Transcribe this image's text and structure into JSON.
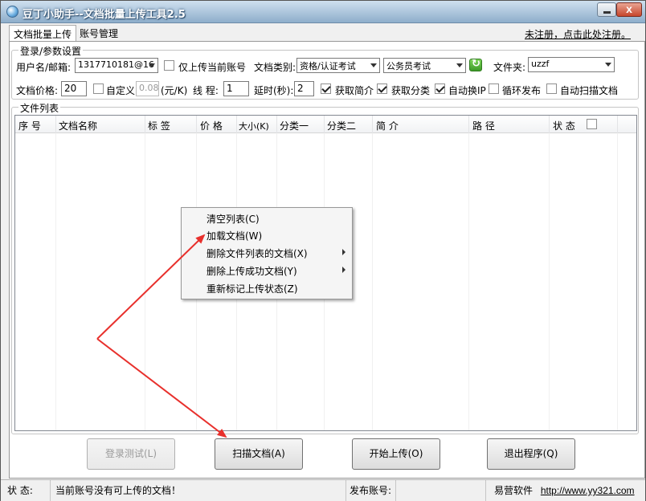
{
  "window": {
    "title": "豆丁小助手--文档批量上传工具2.5"
  },
  "tabs": [
    {
      "label": "文档批量上传",
      "active": true
    },
    {
      "label": "账号管理",
      "active": false
    }
  ],
  "register_link": "未注册，点击此处注册。",
  "settings": {
    "group_label": "登录/参数设置",
    "username_label": "用户名/邮箱:",
    "username_value": "1317710181@16",
    "only_current_label": "仅上传当前账号",
    "only_current_checked": false,
    "doc_type_label": "文档类别:",
    "doc_type_value": "资格/认证考试",
    "doc_subtype_value": "公务员考试",
    "folder_label": "文件夹:",
    "folder_value": "uzzf",
    "price_label": "文档价格:",
    "price_value": "20",
    "custom_label": "自定义",
    "custom_checked": false,
    "custom_value": "0.08",
    "unit_label": "(元/K)",
    "threads_label": "线  程:",
    "threads_value": "1",
    "delay_label": "延时(秒):",
    "delay_value": "2",
    "options": [
      {
        "label": "获取简介",
        "checked": true
      },
      {
        "label": "获取分类",
        "checked": true
      },
      {
        "label": "自动换IP",
        "checked": true
      },
      {
        "label": "循环发布",
        "checked": false
      },
      {
        "label": "自动扫描文档",
        "checked": false
      }
    ]
  },
  "file_list": {
    "group_label": "文件列表",
    "columns": [
      "序  号",
      "文档名称",
      "标  签",
      "价  格",
      "大小(K)",
      "分类一",
      "分类二",
      "简  介",
      "路  径",
      "状  态"
    ]
  },
  "context_menu": {
    "items": [
      {
        "label": "清空列表(C)",
        "submenu": false
      },
      {
        "label": "加载文档(W)",
        "submenu": false
      },
      {
        "label": "删除文件列表的文档(X)",
        "submenu": true
      },
      {
        "label": "删除上传成功文档(Y)",
        "submenu": true
      },
      {
        "label": "重新标记上传状态(Z)",
        "submenu": false
      }
    ]
  },
  "buttons": {
    "login_test": {
      "label": "登录测试(L)",
      "enabled": false
    },
    "scan_docs": {
      "label": "扫描文档(A)",
      "enabled": true
    },
    "start_upload": {
      "label": "开始上传(O)",
      "enabled": true
    },
    "exit": {
      "label": "退出程序(Q)",
      "enabled": true
    }
  },
  "statusbar": {
    "status_label": "状  态:",
    "status_text": "当前账号没有可上传的文档！",
    "publish_label": "发布账号:",
    "publish_value": "",
    "vendor": "易营软件",
    "url": "http://www.yy321.com"
  },
  "colors": {
    "annotation_arrow": "#e8302c",
    "titlebar": "#8eaecb"
  }
}
